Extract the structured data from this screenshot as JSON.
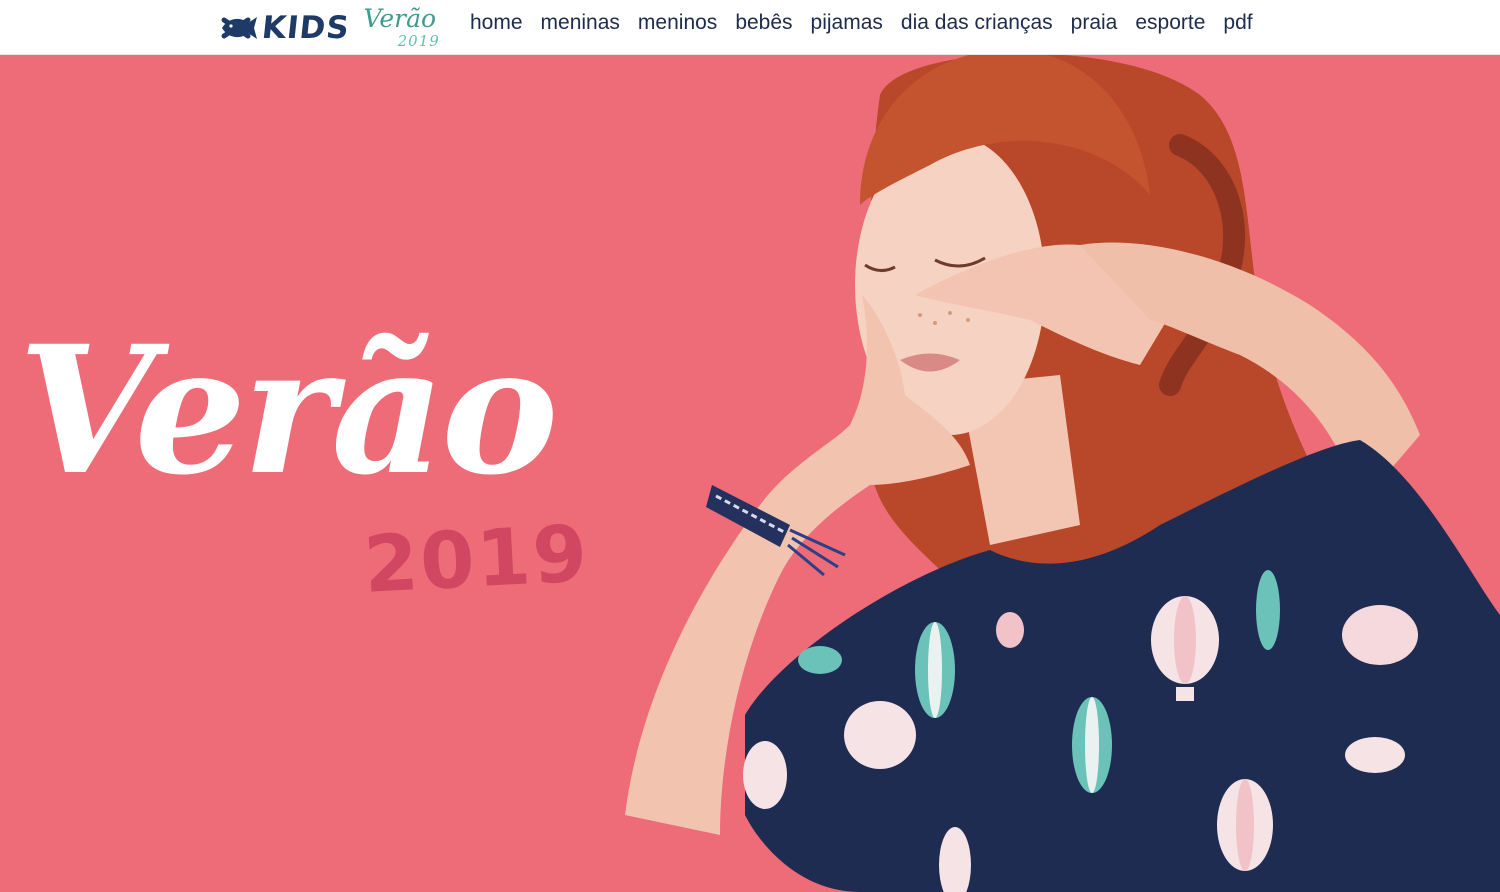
{
  "brand": {
    "logo_icon": "fish-logo-icon",
    "kids": "KIDS",
    "season_word": "Verão",
    "season_year": "2019"
  },
  "nav": {
    "items": [
      {
        "label": "home"
      },
      {
        "label": "meninas"
      },
      {
        "label": "meninos"
      },
      {
        "label": "bebês"
      },
      {
        "label": "pijamas"
      },
      {
        "label": "dia das crianças"
      },
      {
        "label": "praia"
      },
      {
        "label": "esporte"
      },
      {
        "label": "pdf"
      }
    ]
  },
  "hero": {
    "title": "Verão",
    "year": "2019",
    "photo": "girl-in-balloon-print-dress-photo"
  },
  "colors": {
    "hero_background": "#ee6b78",
    "hero_year": "#d14660",
    "nav_text": "#1d2c4c",
    "brand_navy": "#1e3a66",
    "brand_teal": "#3f9b8c"
  }
}
